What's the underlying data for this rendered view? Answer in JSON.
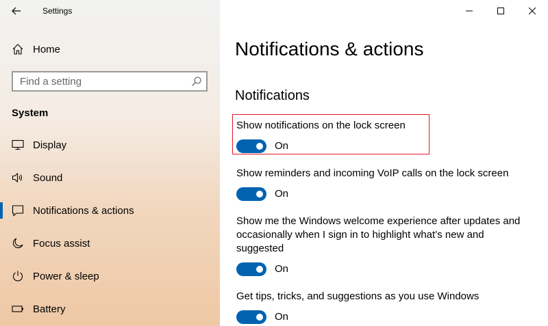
{
  "window": {
    "title": "Settings",
    "controls": {
      "minimize": "minimize-icon",
      "maximize": "maximize-icon",
      "close": "close-icon"
    }
  },
  "sidebar": {
    "home_label": "Home",
    "search": {
      "placeholder": "Find a setting",
      "value": ""
    },
    "section_label": "System",
    "items": [
      {
        "label": "Display",
        "icon": "display-icon"
      },
      {
        "label": "Sound",
        "icon": "speaker-icon"
      },
      {
        "label": "Notifications & actions",
        "icon": "notification-icon",
        "active": true
      },
      {
        "label": "Focus assist",
        "icon": "moon-icon"
      },
      {
        "label": "Power & sleep",
        "icon": "power-icon"
      },
      {
        "label": "Battery",
        "icon": "battery-icon"
      }
    ]
  },
  "main": {
    "title": "Notifications & actions",
    "section_title": "Notifications",
    "settings": [
      {
        "description": "Show notifications on the lock screen",
        "state": "On",
        "on": true,
        "highlighted": true
      },
      {
        "description": "Show reminders and incoming VoIP calls on the lock screen",
        "state": "On",
        "on": true
      },
      {
        "description": "Show me the Windows welcome experience after updates and occasionally when I sign in to highlight what’s new and suggested",
        "state": "On",
        "on": true
      },
      {
        "description": "Get tips, tricks, and suggestions as you use Windows",
        "state": "On",
        "on": true
      }
    ]
  },
  "colors": {
    "accent": "#0063b1",
    "highlight": "#e81123"
  }
}
